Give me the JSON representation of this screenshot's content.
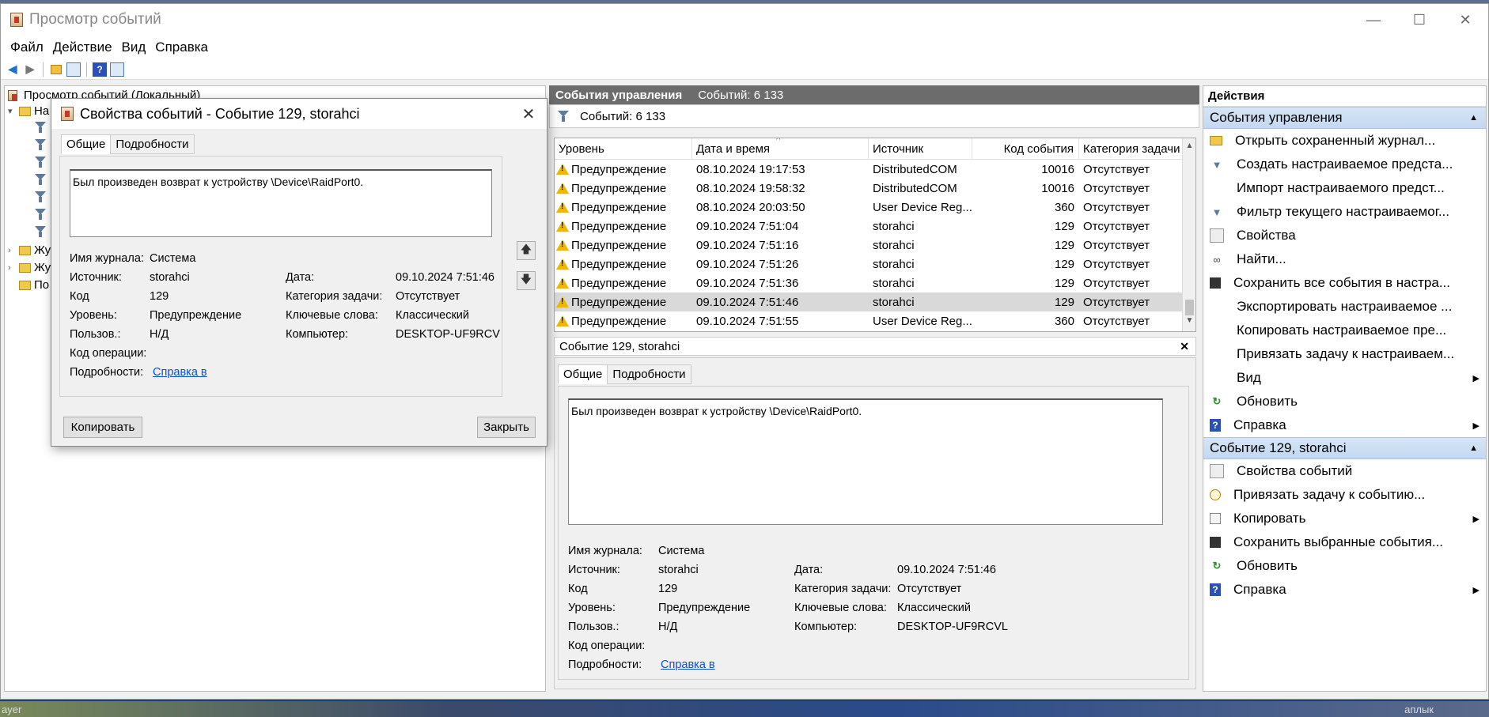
{
  "window": {
    "title": "Просмотр событий",
    "controls": {
      "minimize": "—",
      "maximize": "☐",
      "close": "✕"
    }
  },
  "menu": [
    "Файл",
    "Действие",
    "Вид",
    "Справка"
  ],
  "tree": {
    "root": "Просмотр событий (Локальный)",
    "items": [
      {
        "label": "На",
        "type": "folder",
        "expand": "▾"
      },
      {
        "label": "Жу",
        "type": "folder",
        "expand": "›"
      },
      {
        "label": "Жу",
        "type": "folder",
        "expand": "›"
      },
      {
        "label": "По",
        "type": "folder",
        "expand": ""
      }
    ]
  },
  "center": {
    "header_title": "События управления",
    "header_count": "Событий: 6 133",
    "filter_count": "Событий: 6 133",
    "columns": [
      "Уровень",
      "Дата и время",
      "Источник",
      "Код события",
      "Категория задачи"
    ],
    "rows": [
      {
        "level": "Предупреждение",
        "datetime": "08.10.2024 19:17:53",
        "source": "DistributedCOM",
        "code": "10016",
        "category": "Отсутствует"
      },
      {
        "level": "Предупреждение",
        "datetime": "08.10.2024 19:58:32",
        "source": "DistributedCOM",
        "code": "10016",
        "category": "Отсутствует"
      },
      {
        "level": "Предупреждение",
        "datetime": "08.10.2024 20:03:50",
        "source": "User Device Reg...",
        "code": "360",
        "category": "Отсутствует"
      },
      {
        "level": "Предупреждение",
        "datetime": "09.10.2024 7:51:04",
        "source": "storahci",
        "code": "129",
        "category": "Отсутствует"
      },
      {
        "level": "Предупреждение",
        "datetime": "09.10.2024 7:51:16",
        "source": "storahci",
        "code": "129",
        "category": "Отсутствует"
      },
      {
        "level": "Предупреждение",
        "datetime": "09.10.2024 7:51:26",
        "source": "storahci",
        "code": "129",
        "category": "Отсутствует"
      },
      {
        "level": "Предупреждение",
        "datetime": "09.10.2024 7:51:36",
        "source": "storahci",
        "code": "129",
        "category": "Отсутствует"
      },
      {
        "level": "Предупреждение",
        "datetime": "09.10.2024 7:51:46",
        "source": "storahci",
        "code": "129",
        "category": "Отсутствует"
      },
      {
        "level": "Предупреждение",
        "datetime": "09.10.2024 7:51:55",
        "source": "User Device Reg...",
        "code": "360",
        "category": "Отсутствует"
      }
    ],
    "selected_row": 7
  },
  "detail": {
    "title": "Событие 129, storahci",
    "tabs": [
      "Общие",
      "Подробности"
    ],
    "message": "Был произведен возврат к устройству \\Device\\RaidPort0.",
    "labels": {
      "log": "Имя журнала:",
      "source": "Источник:",
      "code": "Код",
      "level": "Уровень:",
      "user": "Пользов.:",
      "opcode": "Код операции:",
      "more": "Подробности:",
      "date": "Дата:",
      "category": "Категория задачи:",
      "keywords": "Ключевые слова:",
      "computer": "Компьютер:"
    },
    "values": {
      "log": "Система",
      "source": "storahci",
      "code": "129",
      "level": "Предупреждение",
      "user": "Н/Д",
      "opcode": "",
      "more": "Справка в ",
      "date": "09.10.2024 7:51:46",
      "category": "Отсутствует",
      "keywords": "Классический",
      "computer": "DESKTOP-UF9RCVL"
    }
  },
  "dialog": {
    "title": "Свойства событий - Событие 129, storahci",
    "close": "✕",
    "tabs": [
      "Общие",
      "Подробности"
    ],
    "message": "Был произведен возврат к устройству \\Device\\RaidPort0.",
    "values": {
      "log": "Система",
      "source": "storahci",
      "code": "129",
      "level": "Предупреждение",
      "user": "Н/Д",
      "more": "Справка в ",
      "date": "09.10.2024 7:51:46",
      "category": "Отсутствует",
      "keywords": "Классический",
      "computer": "DESKTOP-UF9RCV"
    },
    "copy_button": "Копировать",
    "close_button": "Закрыть",
    "up_arrow": "🡅",
    "down_arrow": "🡇"
  },
  "actions": {
    "title": "Действия",
    "section1": {
      "title": "События управления",
      "items": [
        {
          "label": "Открыть сохраненный журнал...",
          "icon": "open-folder-icon",
          "submenu": false
        },
        {
          "label": "Создать настраиваемое предста...",
          "icon": "filter-create-icon",
          "submenu": false
        },
        {
          "label": "Импорт настраиваемого предст...",
          "icon": "",
          "submenu": false
        },
        {
          "label": "Фильтр текущего настраиваемог...",
          "icon": "filter-icon",
          "submenu": false
        },
        {
          "label": "Свойства",
          "icon": "properties-icon",
          "submenu": false
        },
        {
          "label": "Найти...",
          "icon": "binoculars-icon",
          "submenu": false
        },
        {
          "label": "Сохранить все события в настра...",
          "icon": "save-icon",
          "submenu": false
        },
        {
          "label": "Экспортировать настраиваемое ...",
          "icon": "",
          "submenu": false
        },
        {
          "label": "Копировать настраиваемое пре...",
          "icon": "",
          "submenu": false
        },
        {
          "label": "Привязать задачу к настраиваем...",
          "icon": "",
          "submenu": false
        },
        {
          "label": "Вид",
          "icon": "",
          "submenu": true
        },
        {
          "label": "Обновить",
          "icon": "refresh-icon",
          "submenu": false
        },
        {
          "label": "Справка",
          "icon": "help-icon",
          "submenu": true
        }
      ]
    },
    "section2": {
      "title": "Событие 129, storahci",
      "items": [
        {
          "label": "Свойства событий",
          "icon": "properties-icon",
          "submenu": false
        },
        {
          "label": "Привязать задачу к событию...",
          "icon": "task-icon",
          "submenu": false
        },
        {
          "label": "Копировать",
          "icon": "copy-icon",
          "submenu": true
        },
        {
          "label": "Сохранить выбранные события...",
          "icon": "save-icon",
          "submenu": false
        },
        {
          "label": "Обновить",
          "icon": "refresh-icon",
          "submenu": false
        },
        {
          "label": "Справка",
          "icon": "help-icon",
          "submenu": true
        }
      ]
    }
  },
  "taskbar": {
    "left": "ayer",
    "right": "аплык"
  }
}
